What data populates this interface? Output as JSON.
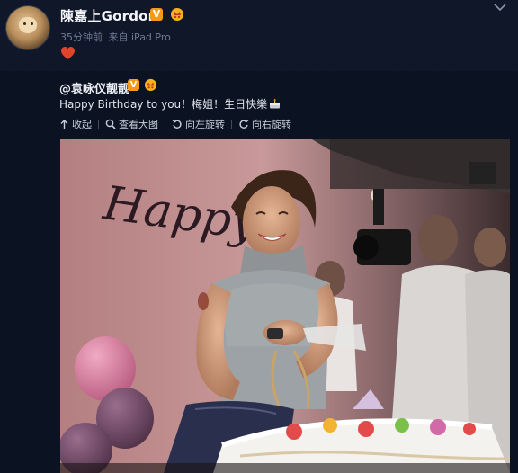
{
  "post": {
    "username": "陳嘉上Gordon",
    "verified_badge": "V",
    "time": "35分钟前",
    "source": "来自 iPad Pro",
    "reaction": "heart",
    "avatar_icon": "avatar-dog"
  },
  "repost": {
    "author": "@袁咏仪靓靓",
    "verified_badge": "V",
    "text": "Happy Birthday to you！梅姐！生日快樂",
    "trailing_emoji": "cake-emoji"
  },
  "actions": [
    {
      "label": "收起",
      "icon": "collapse-icon"
    },
    {
      "label": "查看大图",
      "icon": "magnify-icon"
    },
    {
      "label": "向左旋转",
      "icon": "rotate-left-icon"
    },
    {
      "label": "向右旋转",
      "icon": "rotate-right-icon"
    }
  ],
  "photo": {
    "wall_text": "Happy"
  },
  "colors": {
    "background": "#0f1729",
    "repost_background": "#0b1322",
    "verified_badge": "#f59a12",
    "meta_text": "#6d7a93",
    "heart": "#e0452b"
  }
}
